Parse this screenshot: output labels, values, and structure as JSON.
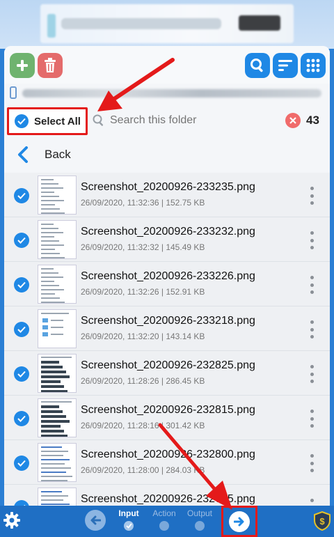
{
  "toolbar": {
    "add_icon": "plus-icon",
    "delete_icon": "trash-icon",
    "search_icon": "search-icon",
    "sort_icon": "sort-icon",
    "grid_icon": "grid-icon"
  },
  "select_bar": {
    "select_all_label": "Select All",
    "search_placeholder": "Search this folder",
    "count": "43"
  },
  "back": {
    "label": "Back"
  },
  "files": [
    {
      "name": "Screenshot_20200926-233235.png",
      "meta": "26/09/2020, 11:32:36 | 152.75 KB",
      "thumb": "menu"
    },
    {
      "name": "Screenshot_20200926-233232.png",
      "meta": "26/09/2020, 11:32:32 | 145.49 KB",
      "thumb": "menu"
    },
    {
      "name": "Screenshot_20200926-233226.png",
      "meta": "26/09/2020, 11:32:26 | 152.91 KB",
      "thumb": "menu"
    },
    {
      "name": "Screenshot_20200926-233218.png",
      "meta": "26/09/2020, 11:32:20 | 143.14 KB",
      "thumb": "folders"
    },
    {
      "name": "Screenshot_20200926-232825.png",
      "meta": "26/09/2020, 11:28:26 | 286.45 KB",
      "thumb": "list"
    },
    {
      "name": "Screenshot_20200926-232815.png",
      "meta": "26/09/2020, 11:28:16 | 301.42 KB",
      "thumb": "list"
    },
    {
      "name": "Screenshot_20200926-232800.png",
      "meta": "26/09/2020, 11:28:00 | 284.03 KB",
      "thumb": "text"
    },
    {
      "name": "Screenshot_20200926-232745.png",
      "meta": "",
      "thumb": "text"
    }
  ],
  "bottom": {
    "steps": [
      {
        "label": "Input",
        "state": "done"
      },
      {
        "label": "Action",
        "state": "pending"
      },
      {
        "label": "Output",
        "state": "pending"
      }
    ]
  },
  "colors": {
    "accent": "#1f88e5",
    "highlight": "#e41a1a",
    "bar": "#1f6fc4"
  }
}
